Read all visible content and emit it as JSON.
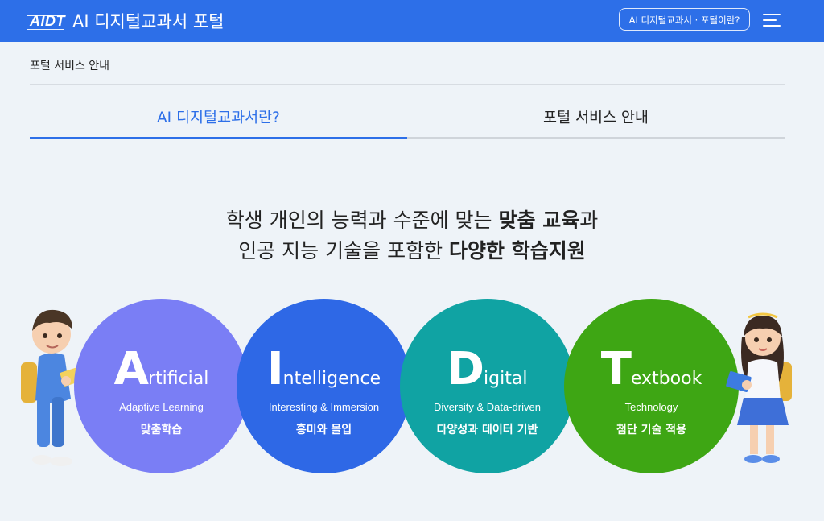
{
  "header": {
    "logo_text": "AIDT",
    "title": "AI 디지털교과서 포털",
    "about_button": "AI 디지털교과서 · 포털이란?",
    "menu_icon": "hamburger-menu-icon",
    "background": "#2d6fe8"
  },
  "breadcrumb": "포털 서비스 안내",
  "tabs": [
    {
      "label": "AI 디지털교과서란?",
      "active": true
    },
    {
      "label": "포털 서비스 안내",
      "active": false
    }
  ],
  "headline": {
    "line1_plain": "학생 개인의 능력과 수준에 맞는 ",
    "line1_bold": "맞춤 교육",
    "line1_tail": "과",
    "line2_plain": "인공 지능 기술을 포함한 ",
    "line2_bold": "다양한 학습지원"
  },
  "pillars": [
    {
      "letter": "A",
      "rest": "rtificial",
      "english": "Adaptive Learning",
      "korean": "맞춤학습",
      "color": "#7a7ef5"
    },
    {
      "letter": "I",
      "rest": "ntelligence",
      "english": "Interesting & Immersion",
      "korean": "흥미와 몰입",
      "color": "#2e68e6"
    },
    {
      "letter": "D",
      "rest": "igital",
      "english": "Diversity & Data-driven",
      "korean": "다양성과 데이터 기반",
      "color": "#10a3a3"
    },
    {
      "letter": "T",
      "rest": "extbook",
      "english": "Technology",
      "korean": "첨단 기술 적용",
      "color": "#3ea614"
    }
  ],
  "colors": {
    "accent": "#2d6fe8",
    "page_bg": "#eef3f8"
  }
}
